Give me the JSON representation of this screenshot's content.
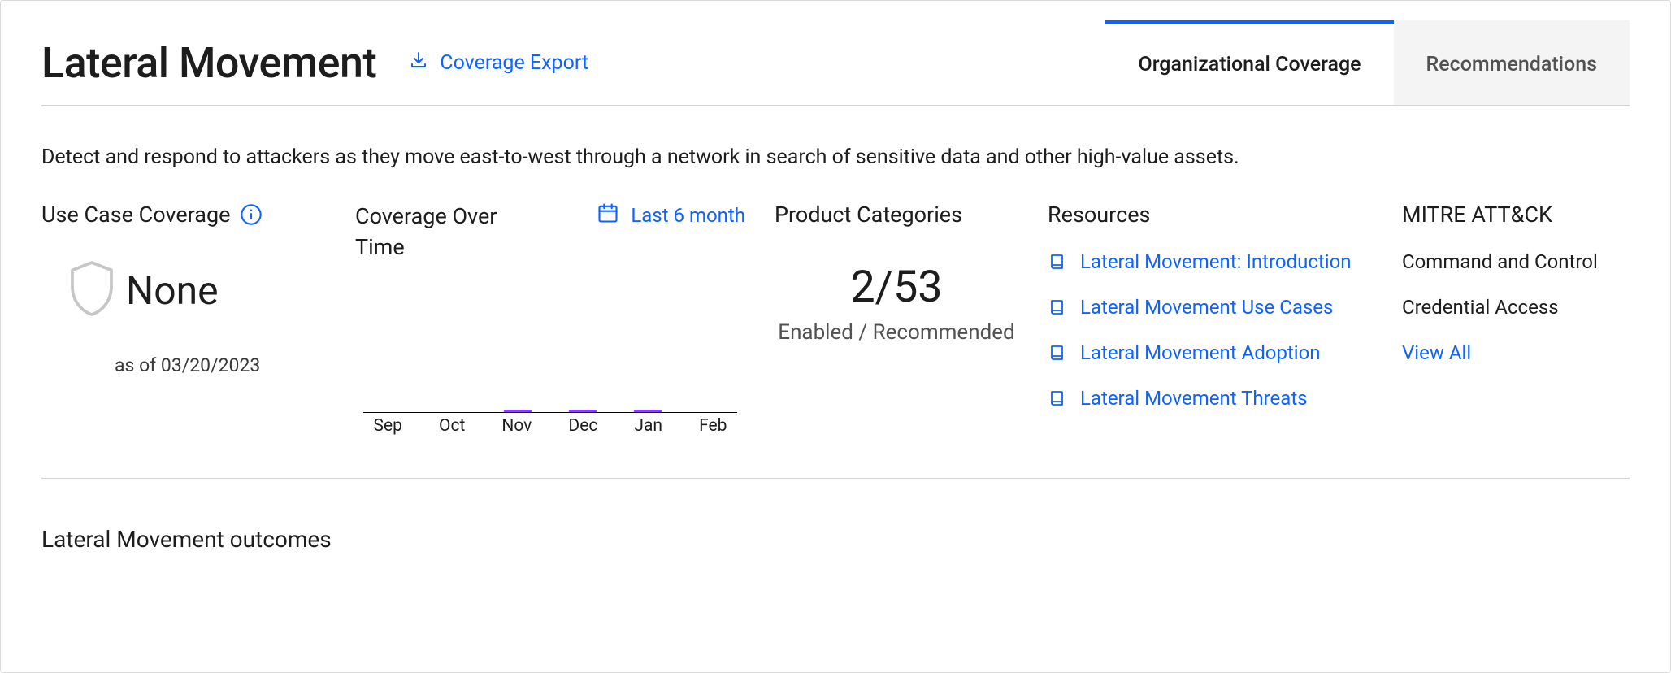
{
  "header": {
    "title": "Lateral Movement",
    "export_label": "Coverage Export"
  },
  "tabs": {
    "org_coverage": "Organizational Coverage",
    "recommendations": "Recommendations"
  },
  "description": "Detect and respond to attackers as they move east-to-west through a network in search of sensitive data and other high-value assets.",
  "use_case_coverage": {
    "title": "Use Case Coverage",
    "value": "None",
    "as_of": "as of 03/20/2023"
  },
  "coverage_over_time": {
    "title": "Coverage Over Time",
    "range_label": "Last 6 month"
  },
  "product_categories": {
    "title": "Product Categories",
    "count": "2/53",
    "sub": "Enabled / Recommended"
  },
  "resources": {
    "title": "Resources",
    "items": [
      "Lateral Movement: Introduction",
      "Lateral Movement Use Cases",
      "Lateral Movement Adoption",
      "Lateral Movement Threats"
    ]
  },
  "mitre": {
    "title": "MITRE ATT&CK",
    "items": [
      "Command and Control",
      "Credential Access"
    ],
    "view_all": "View All"
  },
  "outcomes": {
    "title": "Lateral Movement outcomes"
  },
  "chart_data": {
    "type": "bar",
    "categories": [
      "Sep",
      "Oct",
      "Nov",
      "Dec",
      "Jan",
      "Feb"
    ],
    "values": [
      0,
      0,
      2,
      2,
      2,
      0
    ],
    "title": "Coverage Over Time",
    "xlabel": "",
    "ylabel": "",
    "ylim": [
      0,
      100
    ],
    "series_color": "#8a3ffc"
  }
}
